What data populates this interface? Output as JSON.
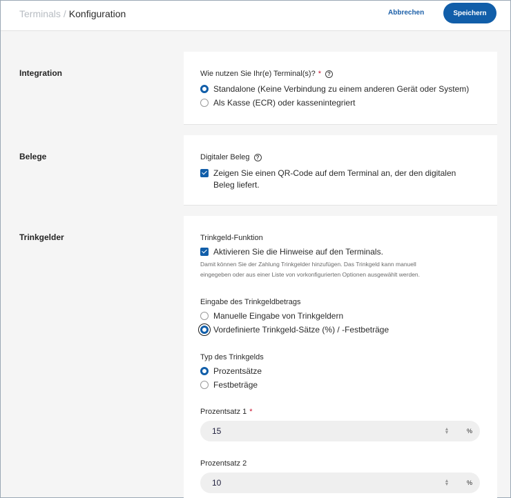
{
  "header": {
    "breadcrumb_parent": "Terminals",
    "breadcrumb_sep": "/",
    "breadcrumb_current": "Konfiguration",
    "cancel_label": "Abbrechen",
    "save_label": "Speichern"
  },
  "integration": {
    "title": "Integration",
    "question": "Wie nutzen Sie Ihr(e) Terminal(s)?",
    "required_mark": "*",
    "options": [
      {
        "label": "Standalone (Keine Verbindung zu einem anderen Gerät oder System)",
        "selected": true
      },
      {
        "label": "Als Kasse (ECR) oder kassenintegriert",
        "selected": false
      }
    ]
  },
  "belege": {
    "title": "Belege",
    "field_label": "Digitaler Beleg",
    "checkbox_label_line1": "Zeigen Sie einen QR-Code auf dem Terminal an, der den digitalen",
    "checkbox_label_line2": "Beleg liefert.",
    "checked": true
  },
  "trinkgelder": {
    "title": "Trinkgelder",
    "function_label": "Trinkgeld-Funktion",
    "function_checkbox_label": "Aktivieren Sie die Hinweise auf den Terminals.",
    "function_checked": true,
    "hint_line1": "Damit können Sie der Zahlung Trinkgelder hinzufügen. Das Trinkgeld kann manuell",
    "hint_line2": "eingegeben oder aus einer Liste von vorkonfigurierten Optionen ausgewählt werden.",
    "entry_label": "Eingabe des Trinkgeldbetrags",
    "entry_options": [
      {
        "label": "Manuelle Eingabe von Trinkgeldern",
        "selected": false
      },
      {
        "label": "Vordefinierte Trinkgeld-Sätze (%) / -Festbeträge",
        "selected": true
      }
    ],
    "type_label": "Typ des Trinkgelds",
    "type_options": [
      {
        "label": "Prozentsätze",
        "selected": true
      },
      {
        "label": "Festbeträge",
        "selected": false
      }
    ],
    "rate1_label": "Prozentsatz 1",
    "rate1_required": "*",
    "rate1_value": "15",
    "rate2_label": "Prozentsatz 2",
    "rate2_value": "10",
    "unit": "%"
  },
  "icons": {
    "help": "question-circle-icon",
    "stepper_up": "▲",
    "stepper_down": "▼"
  },
  "colors": {
    "accent": "#115ea9",
    "required": "#c8102e"
  }
}
